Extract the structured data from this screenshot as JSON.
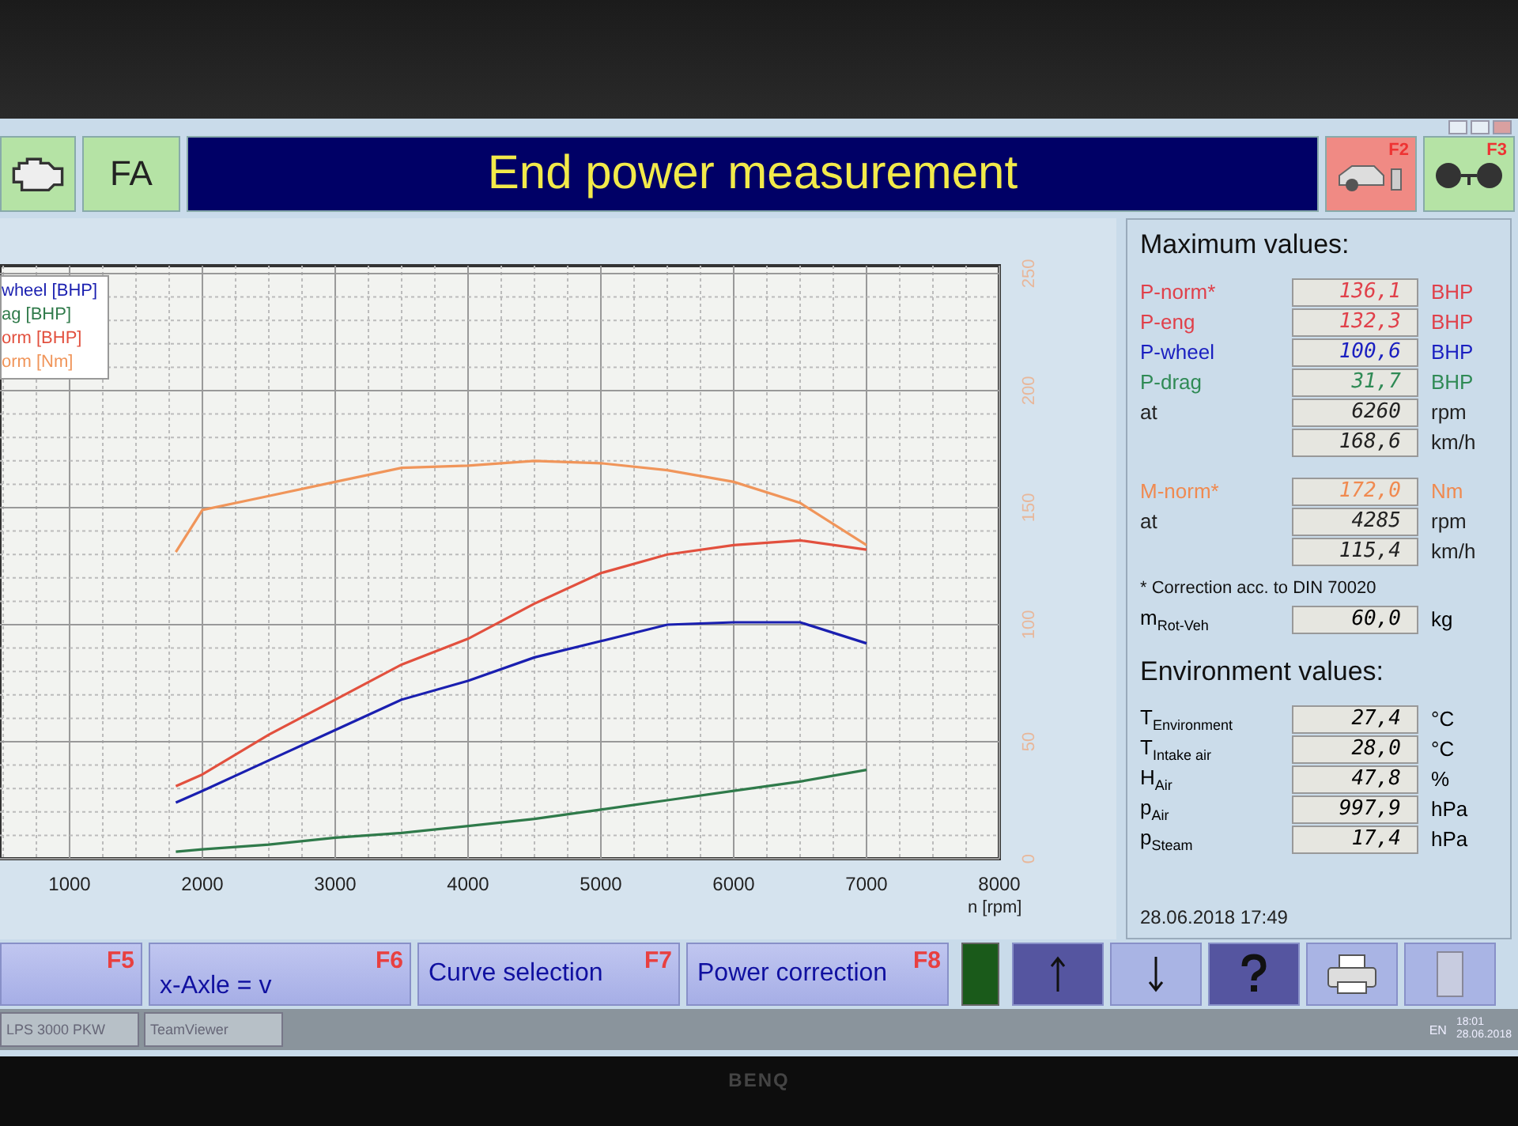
{
  "header": {
    "fa_label": "FA",
    "title": "End power measurement",
    "f2_key": "F2",
    "f3_key": "F3"
  },
  "chart": {
    "chart_data": {
      "type": "line",
      "grid": true,
      "xlabel": "n [rpm]",
      "x": [
        1800,
        2000,
        2500,
        3000,
        3500,
        4000,
        4500,
        5000,
        5500,
        6000,
        6500,
        7000
      ],
      "series": [
        {
          "name": "wheel [BHP]",
          "color": "#1a1fb0",
          "values": [
            24,
            29,
            42,
            55,
            68,
            76,
            86,
            93,
            100,
            101,
            101,
            92
          ]
        },
        {
          "name": "ag [BHP]",
          "color": "#2f7a4a",
          "values": [
            3,
            4,
            6,
            9,
            11,
            14,
            17,
            21,
            25,
            29,
            33,
            38
          ]
        },
        {
          "name": "orm [BHP]",
          "color": "#e2503e",
          "values": [
            31,
            36,
            53,
            68,
            83,
            94,
            109,
            122,
            130,
            134,
            136,
            132
          ]
        },
        {
          "name": "orm [Nm]",
          "color": "#f0955a",
          "values": [
            131,
            149,
            155,
            161,
            167,
            168,
            170,
            169,
            166,
            161,
            152,
            134
          ]
        }
      ],
      "xlim": [
        476,
        8000
      ],
      "ylim": [
        0,
        250
      ],
      "xticks": [
        1000,
        2000,
        3000,
        4000,
        5000,
        6000,
        7000,
        8000
      ],
      "yticks": [
        0,
        50,
        100,
        150,
        200,
        250
      ]
    }
  },
  "max_values": {
    "title": "Maximum values:",
    "groups": [
      [
        {
          "label": "P-norm*",
          "value": "136,1",
          "unit": "BHP",
          "color": "#e0404a"
        },
        {
          "label": "P-eng",
          "value": "132,3",
          "unit": "BHP",
          "color": "#e0404a"
        },
        {
          "label": "P-wheel",
          "value": "100,6",
          "unit": "BHP",
          "color": "#1a1fc0"
        },
        {
          "label": "P-drag",
          "value": "31,7",
          "unit": "BHP",
          "color": "#2f8a55"
        },
        {
          "label": "at",
          "value": "6260",
          "unit": "rpm",
          "color": "#222222"
        },
        {
          "value": "168,6",
          "unit": "km/h",
          "color": "#222222"
        }
      ],
      [
        {
          "label": "M-norm*",
          "value": "172,0",
          "unit": "Nm",
          "color": "#f08a50"
        },
        {
          "label": "at",
          "value": "4285",
          "unit": "rpm",
          "color": "#222222"
        },
        {
          "value": "115,4",
          "unit": "km/h",
          "color": "#222222"
        }
      ]
    ],
    "note": "* Correction acc. to DIN 70020",
    "mass": {
      "label": "m$_{Rot-Veh}$",
      "value": "60,0",
      "unit": "kg"
    }
  },
  "environment": {
    "title": "Environment values:",
    "rows": [
      {
        "label": "T$_{Environment}$",
        "value": "27,4",
        "unit": "°C"
      },
      {
        "label": "T$_{Intake air}$",
        "value": "28,0",
        "unit": "°C"
      },
      {
        "label": "H$_{Air}$",
        "value": "47,8",
        "unit": "%"
      },
      {
        "label": "p$_{Air}$",
        "value": "997,9",
        "unit": "hPa"
      },
      {
        "label": "p$_{Steam}$",
        "value": "17,4",
        "unit": "hPa"
      }
    ],
    "datetime": "28.06.2018  17:49"
  },
  "toolbar": [
    {
      "kind": "fkey",
      "key": "F5"
    },
    {
      "kind": "fkey",
      "key": "F6",
      "label": "x-Axle = v"
    },
    {
      "kind": "fkey",
      "key": "F7",
      "label": "Curve selection"
    },
    {
      "kind": "fkey",
      "key": "F8",
      "label": "Power correction"
    },
    {
      "kind": "meter"
    },
    {
      "kind": "up"
    },
    {
      "kind": "down"
    },
    {
      "kind": "help"
    },
    {
      "kind": "print"
    },
    {
      "kind": "exit"
    }
  ],
  "taskbar": {
    "apps": [
      "LPS 3000 PKW",
      "TeamViewer"
    ],
    "language": "EN",
    "time": "18:01",
    "date": "28.06.2018"
  },
  "monitor": {
    "brand": "BENQ"
  }
}
